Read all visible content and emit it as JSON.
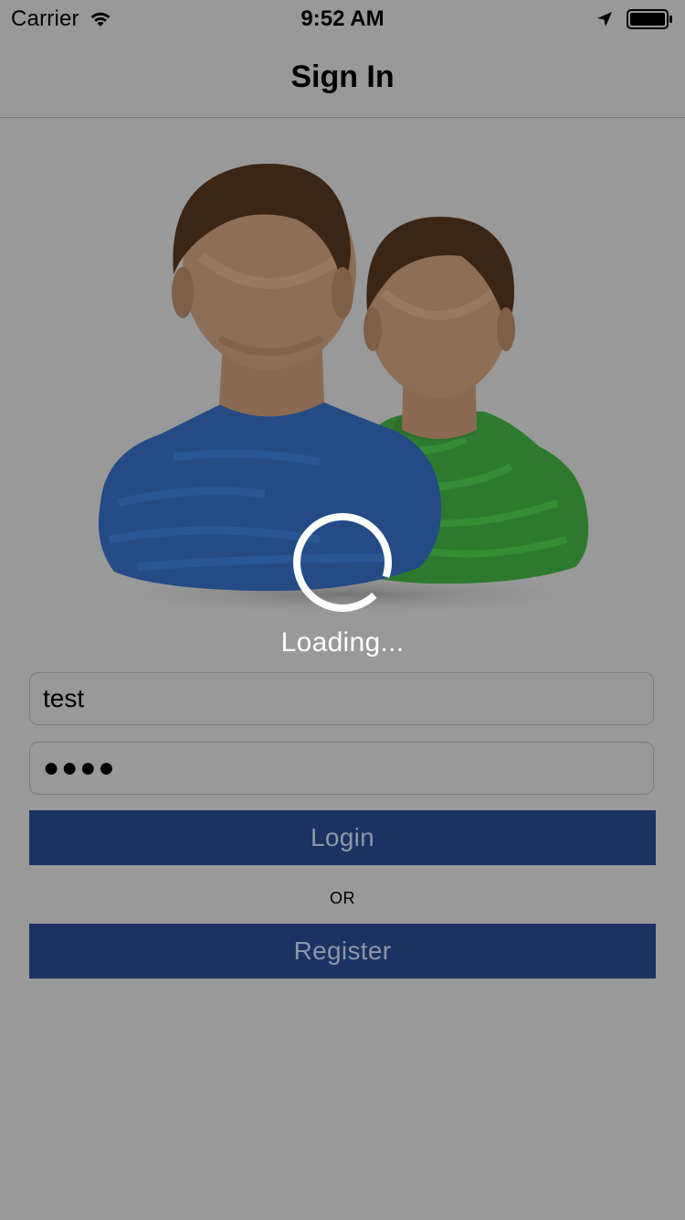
{
  "status_bar": {
    "carrier": "Carrier",
    "time": "9:52 AM",
    "icons": [
      "wifi-icon",
      "location-arrow-icon",
      "battery-icon"
    ]
  },
  "nav": {
    "title": "Sign In"
  },
  "illustration": {
    "icon": "users-icon"
  },
  "loading": {
    "text": "Loading...",
    "icon": "spinner-icon"
  },
  "form": {
    "username_value": "test",
    "password_masked": "●●●●"
  },
  "buttons": {
    "login_label": "Login",
    "or_label": "OR",
    "register_label": "Register"
  },
  "colors": {
    "background": "#999999",
    "button_bg": "#1b3262",
    "button_text": "#8d96a9",
    "loading_text": "#ffffff"
  }
}
